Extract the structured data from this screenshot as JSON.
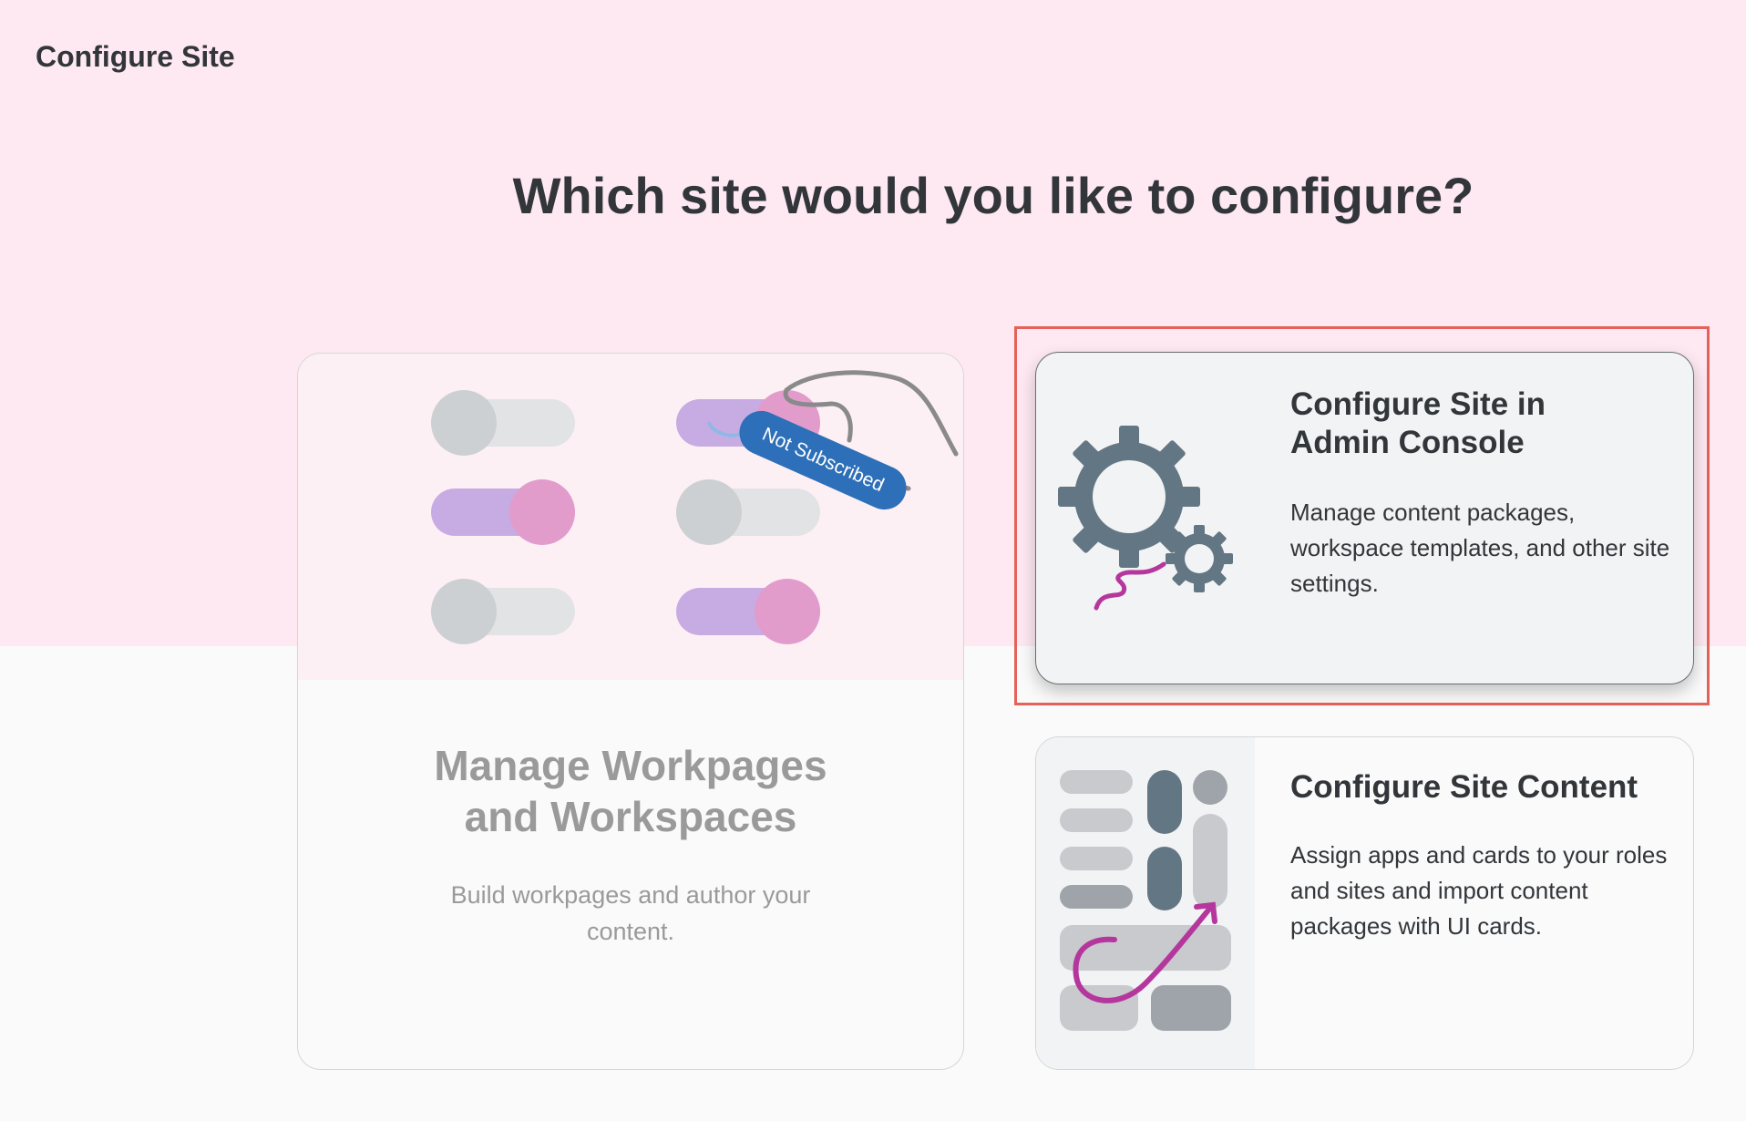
{
  "app": {
    "title": "Configure Site"
  },
  "page": {
    "heading": "Which site would you like to configure?"
  },
  "tiles": {
    "workpages": {
      "title_line1": "Manage Workpages",
      "title_line2": "and Workspaces",
      "description": "Build workpages and author your content.",
      "badge": "Not Subscribed"
    },
    "admin_console": {
      "title_line1": "Configure Site in",
      "title_line2": "Admin Console",
      "description": "Manage content packages, workspace templates, and other site settings."
    },
    "site_content": {
      "title": "Configure Site Content",
      "description": "Assign apps and cards to your roles and sites and import content packages with UI cards."
    }
  },
  "colors": {
    "band": "#fee8f1",
    "accent_highlight": "#e5625a",
    "gear": "#637684",
    "magenta": "#b5379e",
    "badge": "#2d6fb8"
  },
  "icons": [
    "gear-icon",
    "toggle-icon",
    "layout-icon"
  ]
}
